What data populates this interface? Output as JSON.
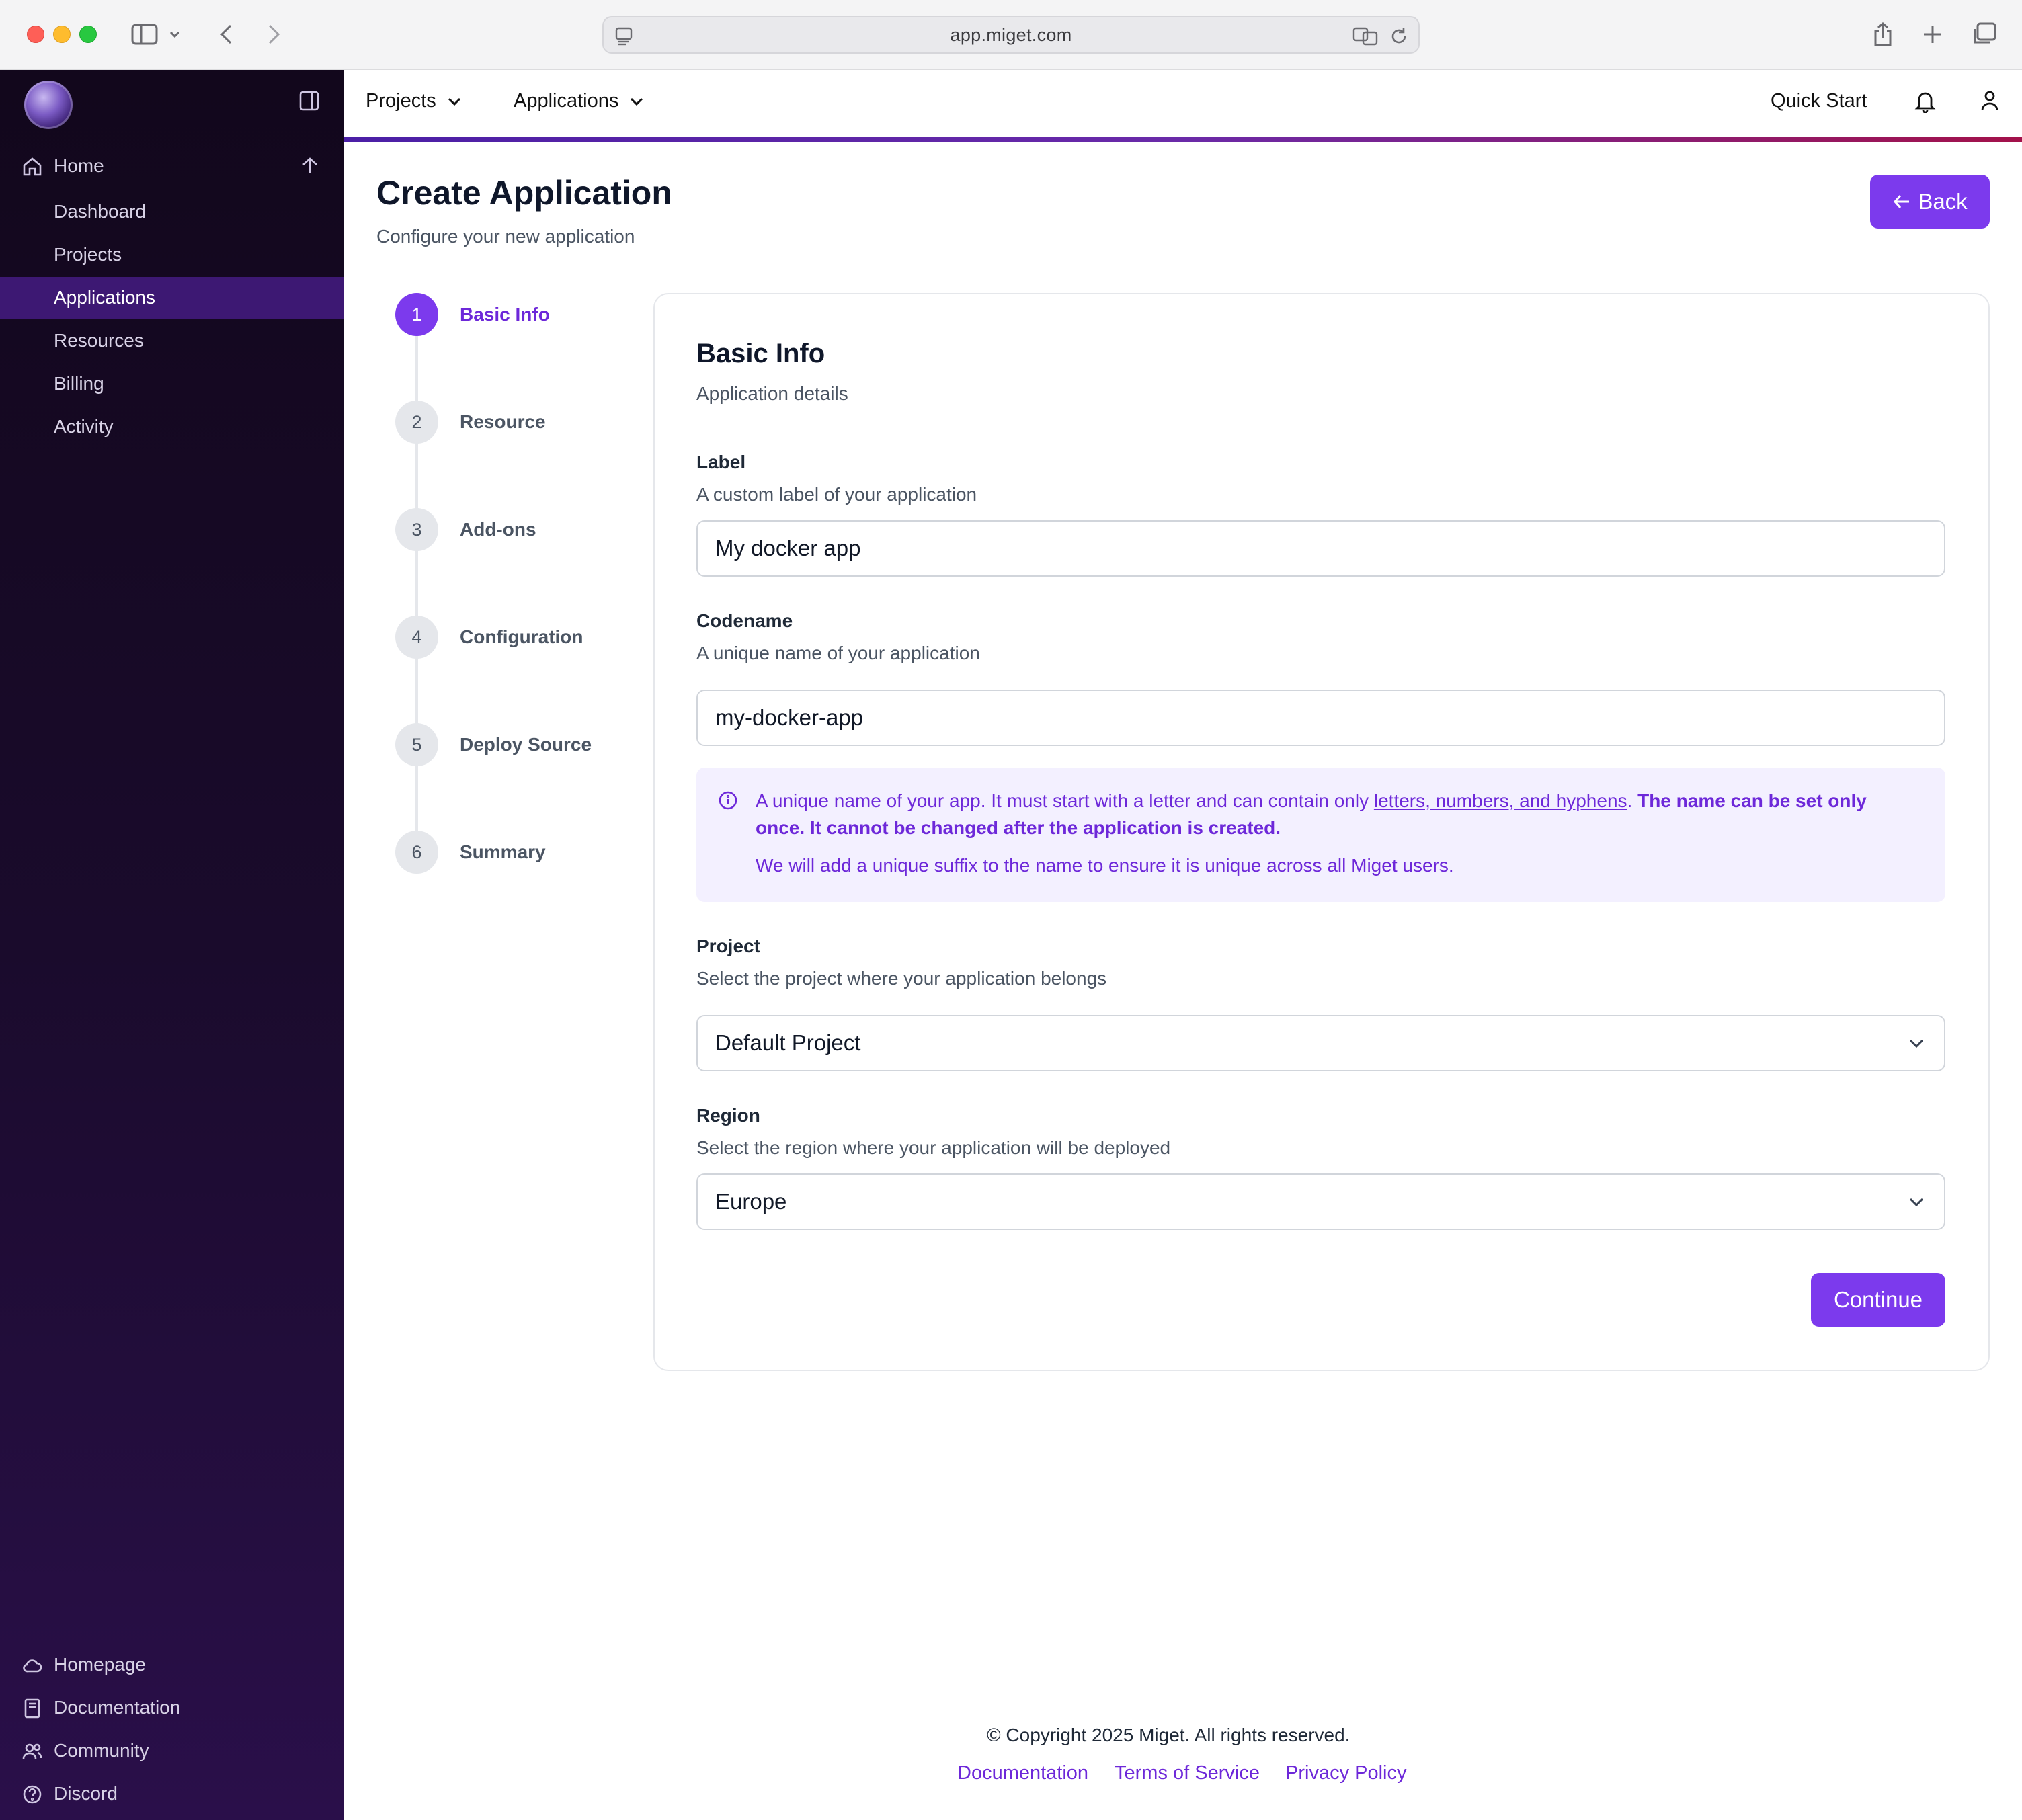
{
  "browser": {
    "url": "app.miget.com"
  },
  "sidebar": {
    "home_label": "Home",
    "items": [
      {
        "label": "Dashboard"
      },
      {
        "label": "Projects"
      },
      {
        "label": "Applications",
        "active": true
      },
      {
        "label": "Resources"
      },
      {
        "label": "Billing"
      },
      {
        "label": "Activity"
      }
    ],
    "bottom_links": [
      {
        "label": "Homepage",
        "icon": "cloud-icon"
      },
      {
        "label": "Documentation",
        "icon": "book-icon"
      },
      {
        "label": "Community",
        "icon": "users-icon"
      },
      {
        "label": "Discord",
        "icon": "help-circle-icon"
      }
    ]
  },
  "topnav": {
    "projects_label": "Projects",
    "applications_label": "Applications",
    "quick_start_label": "Quick Start"
  },
  "page": {
    "title": "Create Application",
    "subtitle": "Configure your new application",
    "back_label": "Back"
  },
  "steps": [
    {
      "number": "1",
      "label": "Basic Info",
      "active": true
    },
    {
      "number": "2",
      "label": "Resource"
    },
    {
      "number": "3",
      "label": "Add-ons"
    },
    {
      "number": "4",
      "label": "Configuration"
    },
    {
      "number": "5",
      "label": "Deploy Source"
    },
    {
      "number": "6",
      "label": "Summary"
    }
  ],
  "form": {
    "title": "Basic Info",
    "subtitle": "Application details",
    "label": {
      "title": "Label",
      "help": "A custom label of your application",
      "value": "My docker app"
    },
    "codename": {
      "title": "Codename",
      "help": "A unique name of your application",
      "value": "my-docker-app"
    },
    "info": {
      "text_start": "A unique name of your app. It must start with a letter and can contain only ",
      "link_text": "letters, numbers, and hyphens",
      "text_mid": ". ",
      "bold_text": "The name can be set only once. It cannot be changed after the application is created.",
      "line2": "We will add a unique suffix to the name to ensure it is unique across all Miget users."
    },
    "project": {
      "title": "Project",
      "help": "Select the project where your application belongs",
      "value": "Default Project"
    },
    "region": {
      "title": "Region",
      "help": "Select the region where your application will be deployed",
      "value": "Europe"
    },
    "continue_label": "Continue"
  },
  "footer": {
    "copyright": "© Copyright 2025 Miget. All rights reserved.",
    "links": [
      "Documentation",
      "Terms of Service",
      "Privacy Policy"
    ]
  },
  "colors": {
    "accent": "#7c3aed",
    "accent_text": "#6d28d9",
    "sidebar_bg": "#1a0b2c",
    "sidebar_active": "#3d1873",
    "info_bg": "#f3f0ff"
  }
}
